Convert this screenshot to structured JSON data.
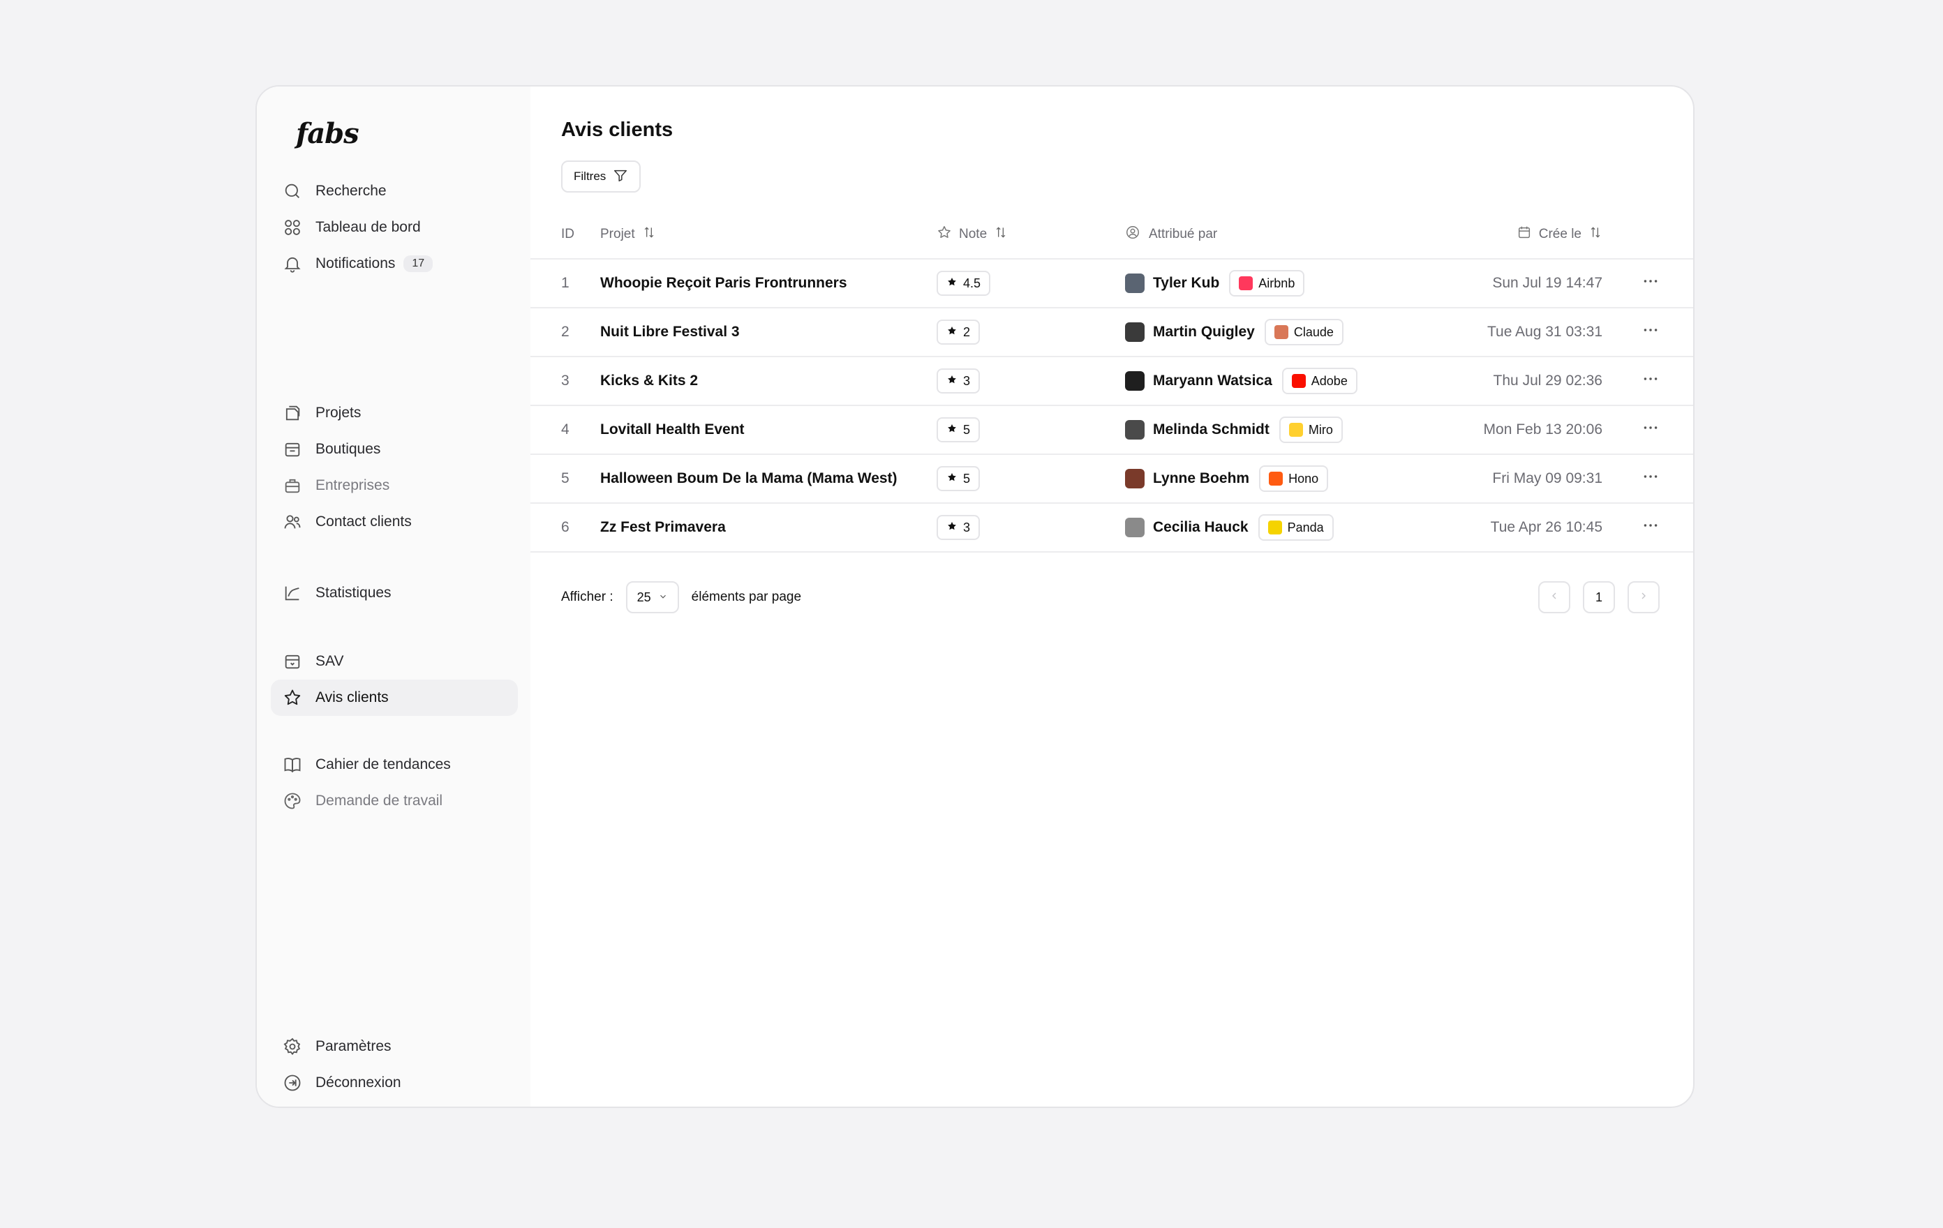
{
  "brand": {
    "logo_text": "fabs"
  },
  "sidebar": {
    "group1": [
      {
        "label": "Recherche",
        "icon": "search-icon"
      },
      {
        "label": "Tableau de bord",
        "icon": "dashboard-icon"
      },
      {
        "label": "Notifications",
        "icon": "bell-icon",
        "badge": "17"
      }
    ],
    "group2": [
      {
        "label": "Projets",
        "icon": "projects-icon"
      },
      {
        "label": "Boutiques",
        "icon": "store-icon"
      },
      {
        "label": "Entreprises",
        "icon": "briefcase-icon"
      },
      {
        "label": "Contact clients",
        "icon": "users-icon"
      }
    ],
    "group3": [
      {
        "label": "Statistiques",
        "icon": "chart-line-icon"
      }
    ],
    "group4": [
      {
        "label": "SAV",
        "icon": "support-icon"
      },
      {
        "label": "Avis clients",
        "icon": "star-icon",
        "active": true
      }
    ],
    "group5": [
      {
        "label": "Cahier de tendances",
        "icon": "book-icon"
      },
      {
        "label": "Demande de travail",
        "icon": "palette-icon"
      }
    ],
    "bottom": [
      {
        "label": "Paramètres",
        "icon": "gear-icon"
      },
      {
        "label": "Déconnexion",
        "icon": "logout-icon"
      }
    ]
  },
  "main": {
    "title": "Avis clients",
    "filter_label": "Filtres",
    "columns": {
      "id": "ID",
      "project": "Projet",
      "note": "Note",
      "assigned": "Attribué par",
      "created": "Crée le"
    },
    "rows": [
      {
        "id": "1",
        "project": "Whoopie Reçoit Paris Frontrunners",
        "note": "4.5",
        "person": "Tyler Kub",
        "company": "Airbnb",
        "company_color": "#ff385c",
        "avatar_color": "#5a6472",
        "date": "Sun Jul 19 14:47"
      },
      {
        "id": "2",
        "project": "Nuit Libre Festival 3",
        "note": "2",
        "person": "Martin Quigley",
        "company": "Claude",
        "company_color": "#d97757",
        "avatar_color": "#3a3a3a",
        "date": "Tue Aug 31 03:31"
      },
      {
        "id": "3",
        "project": "Kicks & Kits 2",
        "note": "3",
        "person": "Maryann Watsica",
        "company": "Adobe",
        "company_color": "#fa0f00",
        "avatar_color": "#1f1f1f",
        "date": "Thu Jul 29 02:36"
      },
      {
        "id": "4",
        "project": "Lovitall Health Event",
        "note": "5",
        "person": "Melinda Schmidt",
        "company": "Miro",
        "company_color": "#ffd02f",
        "avatar_color": "#4a4a4a",
        "date": "Mon Feb 13 20:06"
      },
      {
        "id": "5",
        "project": "Halloween Boum De la Mama (Mama West)",
        "note": "5",
        "person": "Lynne Boehm",
        "company": "Hono",
        "company_color": "#ff5b11",
        "avatar_color": "#7a3a2a",
        "date": "Fri May 09 09:31"
      },
      {
        "id": "6",
        "project": "Zz Fest Primavera",
        "note": "3",
        "person": "Cecilia Hauck",
        "company": "Panda",
        "company_color": "#f5d300",
        "avatar_color": "#8a8a8a",
        "date": "Tue Apr 26 10:45"
      }
    ],
    "pagination": {
      "show_label": "Afficher :",
      "per_page": "25",
      "per_page_suffix": "éléments par page",
      "current_page": "1"
    }
  }
}
